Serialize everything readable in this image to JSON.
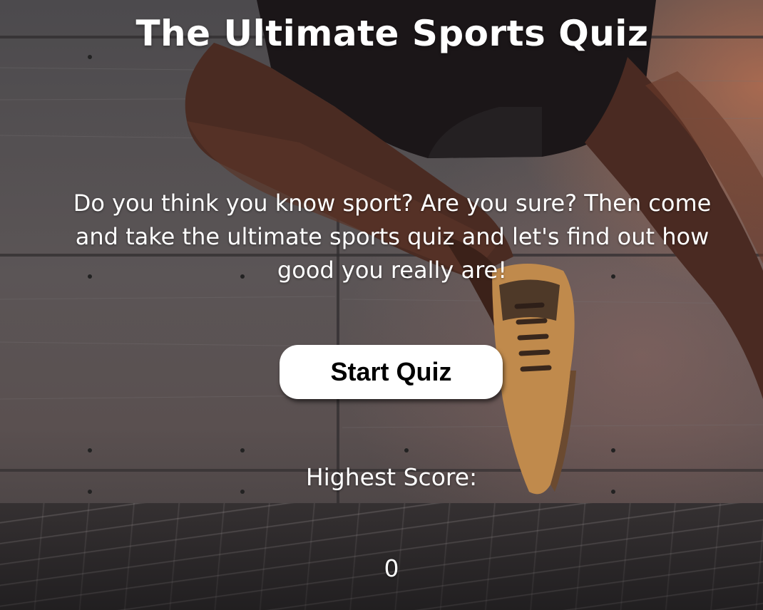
{
  "page": {
    "title": "The Ultimate Sports Quiz",
    "intro": "Do you think you know sport? Are you sure? Then come and take the ultimate sports quiz and let's find out how good you really are!",
    "start_button_label": "Start Quiz",
    "highest_score_label": "Highest Score:",
    "highest_score_value": "0"
  },
  "theme": {
    "text_color": "#ffffff",
    "button_background": "#ffffff",
    "button_text_color": "#000000",
    "background_description_icon": "athlete-running-photo"
  }
}
